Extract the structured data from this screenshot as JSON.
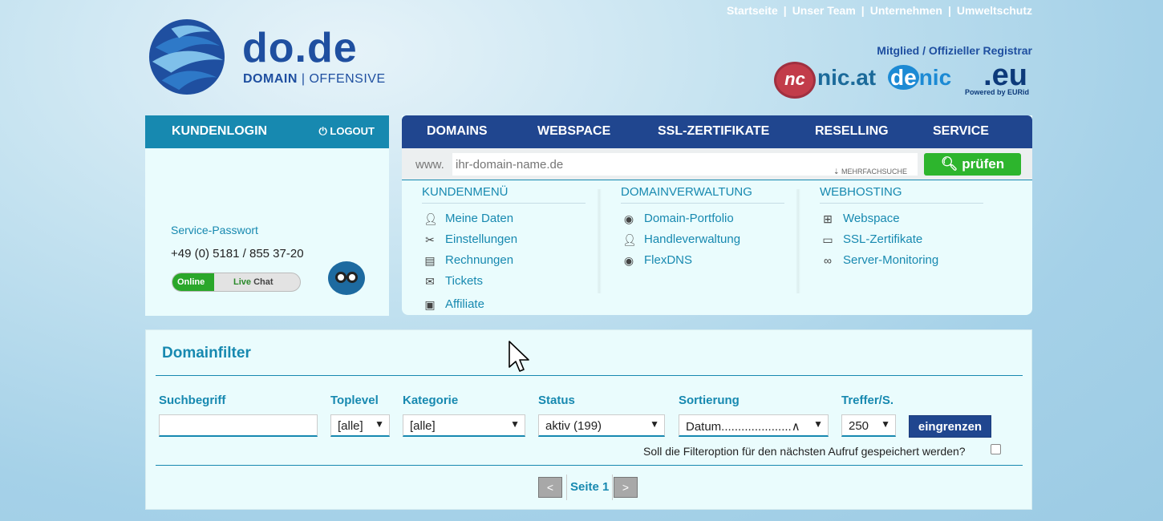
{
  "top_nav": {
    "links": [
      "Startseite",
      "Unser Team",
      "Unternehmen",
      "Umweltschutz"
    ],
    "separator": "|"
  },
  "logo": {
    "brand": "do.de",
    "sub_bold": "DOMAIN",
    "sub_sep": "|",
    "sub_light": "OFFENSIVE"
  },
  "registrar": {
    "title": "Mitglied / Offizieller Registrar",
    "nicat_mark": "nc",
    "nicat_text": "nic.at",
    "denic_de": "de",
    "denic_nic": "nic",
    "eu_text": ".eu",
    "eu_sub": "Powered by EURid"
  },
  "login": {
    "title": "KUNDENLOGIN",
    "logout": "LOGOUT",
    "service_label": "Service-Passwort",
    "phone": "+49 (0) 5181 / 855 37-20",
    "chat_online": "Online",
    "chat_live": "Live",
    "chat_chat": "Chat"
  },
  "main_nav": {
    "items": [
      "DOMAINS",
      "WEBSPACE",
      "SSL-ZERTIFIKATE",
      "RESELLING",
      "SERVICE"
    ]
  },
  "search": {
    "prefix": "www.",
    "placeholder": "ihr-domain-name.de",
    "multi": "⇣ MEHRFACHSUCHE",
    "button": "prüfen"
  },
  "menu": {
    "kunden": {
      "title": "KUNDENMENÜ",
      "items": [
        {
          "label": "Meine Daten",
          "icon": "user-icon"
        },
        {
          "label": "Einstellungen",
          "icon": "tools-icon"
        },
        {
          "label": "Rechnungen",
          "icon": "invoice-icon"
        },
        {
          "label": "Tickets",
          "icon": "mail-icon"
        },
        {
          "label": "Affiliate",
          "icon": "money-icon"
        }
      ]
    },
    "domain": {
      "title": "DOMAINVERWALTUNG",
      "items": [
        {
          "label": "Domain-Portfolio",
          "icon": "globe-icon"
        },
        {
          "label": "Handleverwaltung",
          "icon": "user-icon"
        },
        {
          "label": "FlexDNS",
          "icon": "globe-icon"
        }
      ]
    },
    "web": {
      "title": "WEBHOSTING",
      "items": [
        {
          "label": "Webspace",
          "icon": "sitemap-icon"
        },
        {
          "label": "SSL-Zertifikate",
          "icon": "certificate-icon"
        },
        {
          "label": "Server-Monitoring",
          "icon": "binoculars-icon"
        }
      ]
    }
  },
  "filter": {
    "title": "Domainfilter",
    "labels": {
      "search": "Suchbegriff",
      "tld": "Toplevel",
      "category": "Kategorie",
      "status": "Status",
      "sort": "Sortierung",
      "hits": "Treffer/S."
    },
    "values": {
      "search": "",
      "tld": "[alle]",
      "category": "[alle]",
      "status": "aktiv (199)",
      "sort": "Datum.....................∧",
      "hits": "250"
    },
    "button": "eingrenzen",
    "save_question": "Soll die Filteroption für den nächsten Aufruf gespeichert werden?",
    "pager": {
      "prev": "<",
      "page": "Seite 1",
      "next": ">"
    }
  },
  "colors": {
    "accent_blue": "#1789b0",
    "nav_blue": "#20468f",
    "green": "#2db52d"
  }
}
